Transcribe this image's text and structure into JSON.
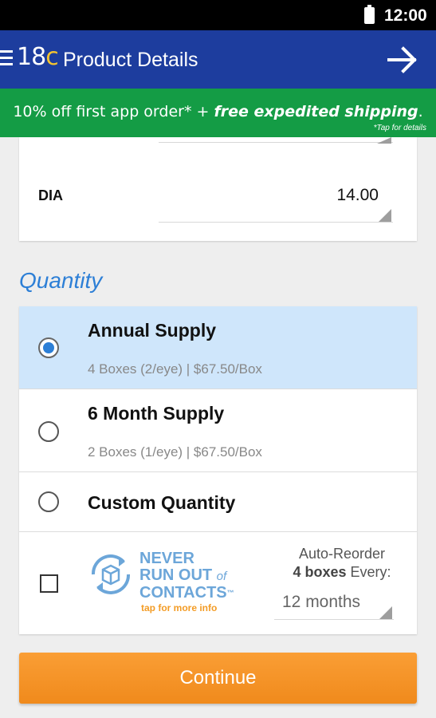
{
  "status_bar": {
    "time": "12:00"
  },
  "app_bar": {
    "logo_num": "18",
    "logo_c": "c",
    "title": "Product Details"
  },
  "promo": {
    "main": "10% off first app order* + ",
    "highlight": "free expedited shipping",
    "end": ".",
    "details": "*Tap for details"
  },
  "prescription": {
    "dia_label": "DIA",
    "dia_value": "14.00"
  },
  "quantity": {
    "title": "Quantity",
    "options": [
      {
        "name": "Annual Supply",
        "sub": "4 Boxes (2/eye) | $67.50/Box",
        "selected": true
      },
      {
        "name": "6 Month Supply",
        "sub": "2 Boxes (1/eye) | $67.50/Box",
        "selected": false
      },
      {
        "name": "Custom Quantity",
        "selected": false
      }
    ],
    "auto_reorder": {
      "line1": "NEVER",
      "line2a": "RUN OUT",
      "line2b": "of",
      "line3": "CONTACTS",
      "tm": "™",
      "tap": "tap for more info",
      "label": "Auto-Reorder",
      "boxes": "4 boxes",
      "every": "Every:",
      "interval": "12 months"
    }
  },
  "continue_label": "Continue",
  "colors": {
    "app_bar": "#1d3d9e",
    "promo": "#149c45",
    "accent": "#2d7fd6",
    "button": "#f7941d",
    "selected_row": "#cfe6fb"
  }
}
